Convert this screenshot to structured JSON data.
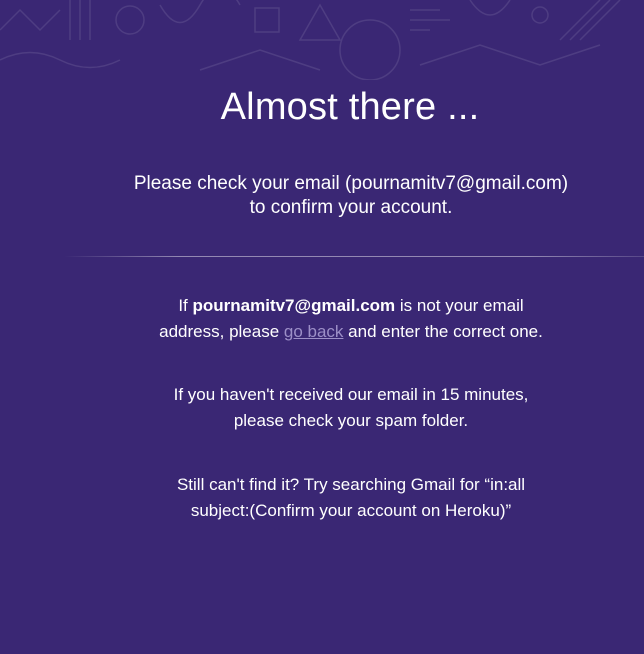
{
  "colors": {
    "background": "#3a2774",
    "text": "#ffffff",
    "link": "#9c8fc7"
  },
  "heading": "Almost there ...",
  "lead": {
    "line1": "Please check your email (pournamitv7@gmail.com)",
    "line2": "to confirm your account."
  },
  "paragraph1": {
    "prefix": "If ",
    "email": "pournamitv7@gmail.com",
    "middle": " is not your email",
    "line2_prefix": "address, please ",
    "link": "go back",
    "suffix": " and enter the correct one."
  },
  "paragraph2": {
    "line1": "If you haven't received our email in 15 minutes,",
    "line2": "please check your spam folder."
  },
  "paragraph3": {
    "line1": "Still can't find it? Try searching Gmail for “in:all",
    "line2": "subject:(Confirm your account on Heroku)”"
  }
}
